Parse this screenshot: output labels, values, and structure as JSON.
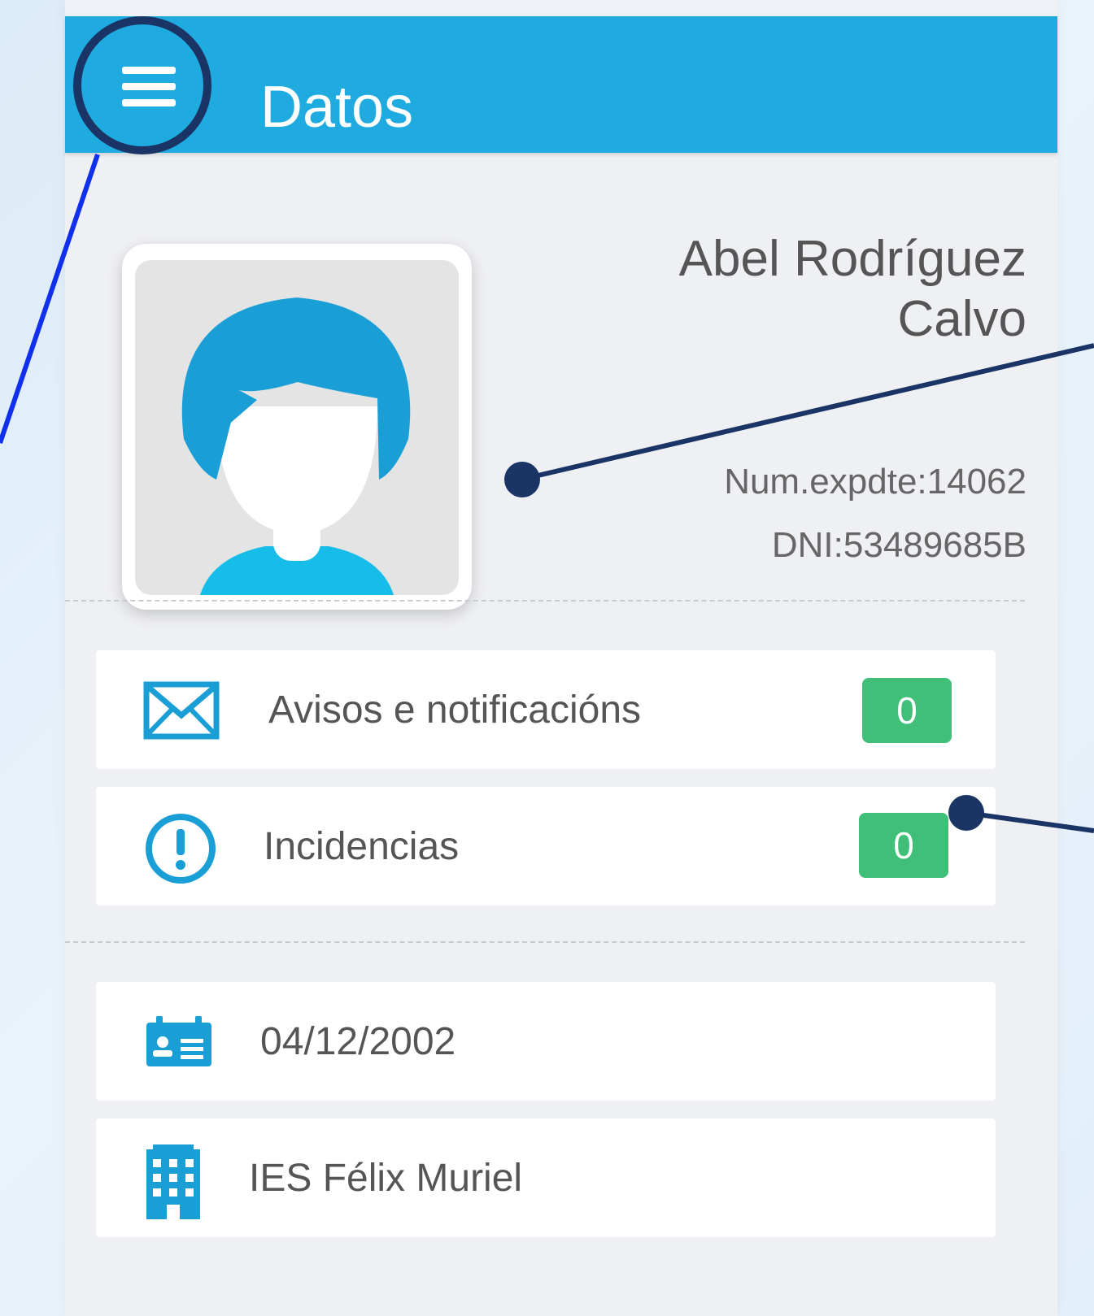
{
  "app_bar": {
    "title": "Datos",
    "menu_icon": "hamburger-menu-icon"
  },
  "profile": {
    "name_line1": "Abel Rodríguez",
    "name_line2": "Calvo",
    "expediente": "Num.expdte:14062",
    "dni": "DNI:53489685B",
    "avatar_icon": "user-avatar-icon"
  },
  "notifications": {
    "items": [
      {
        "label": "Avisos e notificacións",
        "count": "0",
        "icon": "envelope-icon"
      },
      {
        "label": "Incidencias",
        "count": "0",
        "icon": "alert-circle-icon"
      }
    ]
  },
  "details": {
    "items": [
      {
        "value": "04/12/2002",
        "icon": "id-card-calendar-icon"
      },
      {
        "value": "IES Félix Muriel",
        "icon": "building-icon"
      }
    ]
  },
  "colors": {
    "app_bar": "#1faae0",
    "badge": "#3fbf78",
    "icon": "#1a9ed6",
    "annotation": "#1b3466",
    "annotation_line": "#1030ee"
  }
}
